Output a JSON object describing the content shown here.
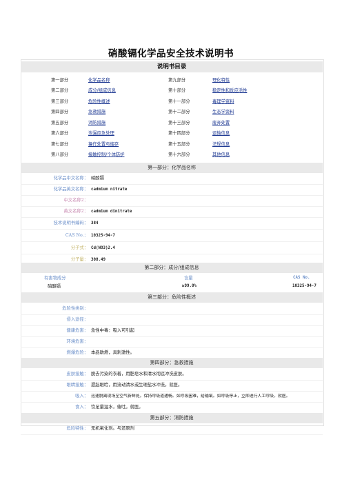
{
  "document": {
    "title": "硝酸镉化学品安全技术说明书"
  },
  "toc": {
    "heading": "说明书目录",
    "rows": [
      {
        "p1": "第一部分",
        "l1": "化学品名称",
        "p2": "第九部分",
        "l2": "理化特性"
      },
      {
        "p1": "第二部分",
        "l1": "成分/组成信息",
        "p2": "第十部分",
        "l2": "稳定性和反应活性"
      },
      {
        "p1": "第三部分",
        "l1": "危险性概述",
        "p2": "第十一部分",
        "l2": "毒理学资料"
      },
      {
        "p1": "第四部分",
        "l1": "急救措施",
        "p2": "第十二部分",
        "l2": "生态学资料"
      },
      {
        "p1": "第五部分",
        "l1": "消防措施",
        "p2": "第十三部分",
        "l2": "废弃处置"
      },
      {
        "p1": "第六部分",
        "l1": "泄漏应急处理",
        "p2": "第十四部分",
        "l2": "运输信息"
      },
      {
        "p1": "第七部分",
        "l1": "操作处置与储存",
        "p2": "第十五部分",
        "l2": "法规信息"
      },
      {
        "p1": "第八部分",
        "l1": "接触控制/个体防护",
        "p2": "第十六部分",
        "l2": "其他信息"
      }
    ]
  },
  "sections": {
    "s1": {
      "heading": "第一部分：化学品名称",
      "rows": [
        {
          "k": "化学品中文名称：",
          "v": "硝酸镉"
        },
        {
          "k": "化学品英文名称：",
          "v": "cadmium nitrate"
        },
        {
          "k": "中文名称2：",
          "v": ""
        },
        {
          "k": "英文名称2：",
          "v": "cadmium dinitrate"
        },
        {
          "k": "技术说明书编码：",
          "v": "384"
        },
        {
          "k": "CAS No.：",
          "v": "10325-94-7"
        },
        {
          "k": "分子式：",
          "v": "Cd(NO3)2.4"
        },
        {
          "k": "分子量：",
          "v": "308.49"
        }
      ]
    },
    "s2": {
      "heading": "第二部分：成分/组成信息",
      "col_component": "有害物成分",
      "col_content": "含量",
      "col_cas": "CAS No.",
      "component": "硝酸镉",
      "content": "≥99.0%",
      "cas": "10325-94-7"
    },
    "s3": {
      "heading": "第三部分：危险性概述",
      "rows": [
        {
          "k": "危险性类别：",
          "v": ""
        },
        {
          "k": "侵入途径：",
          "v": ""
        },
        {
          "k": "健康危害：",
          "v": "急性中毒：吸入可引起"
        },
        {
          "k": "环境危害：",
          "v": ""
        },
        {
          "k": "燃爆危险：",
          "v": "本品助燃，具刺激性。"
        }
      ]
    },
    "s4": {
      "heading": "第四部分：急救措施",
      "rows": [
        {
          "k": "皮肤接触：",
          "v": "脱去污染的衣着，用肥皂水和清水彻底冲洗皮肤。"
        },
        {
          "k": "眼睛接触：",
          "v": "提起眼睑，用流动清水或生理盐水冲洗。就医。"
        },
        {
          "k": "吸入：",
          "v": "迅速脱离现场至空气新鲜处。保持呼吸道通畅。如呼吸困难，给输氧。如呼吸停止，立即进行人工呼吸。就医。"
        },
        {
          "k": "食入：",
          "v": "饮足量温水，催吐。就医。"
        }
      ]
    },
    "s5": {
      "heading": "第五部分：消防措施",
      "rows": [
        {
          "k": "危险特性：",
          "v": "无机氧化剂。与还原剂"
        }
      ]
    }
  }
}
